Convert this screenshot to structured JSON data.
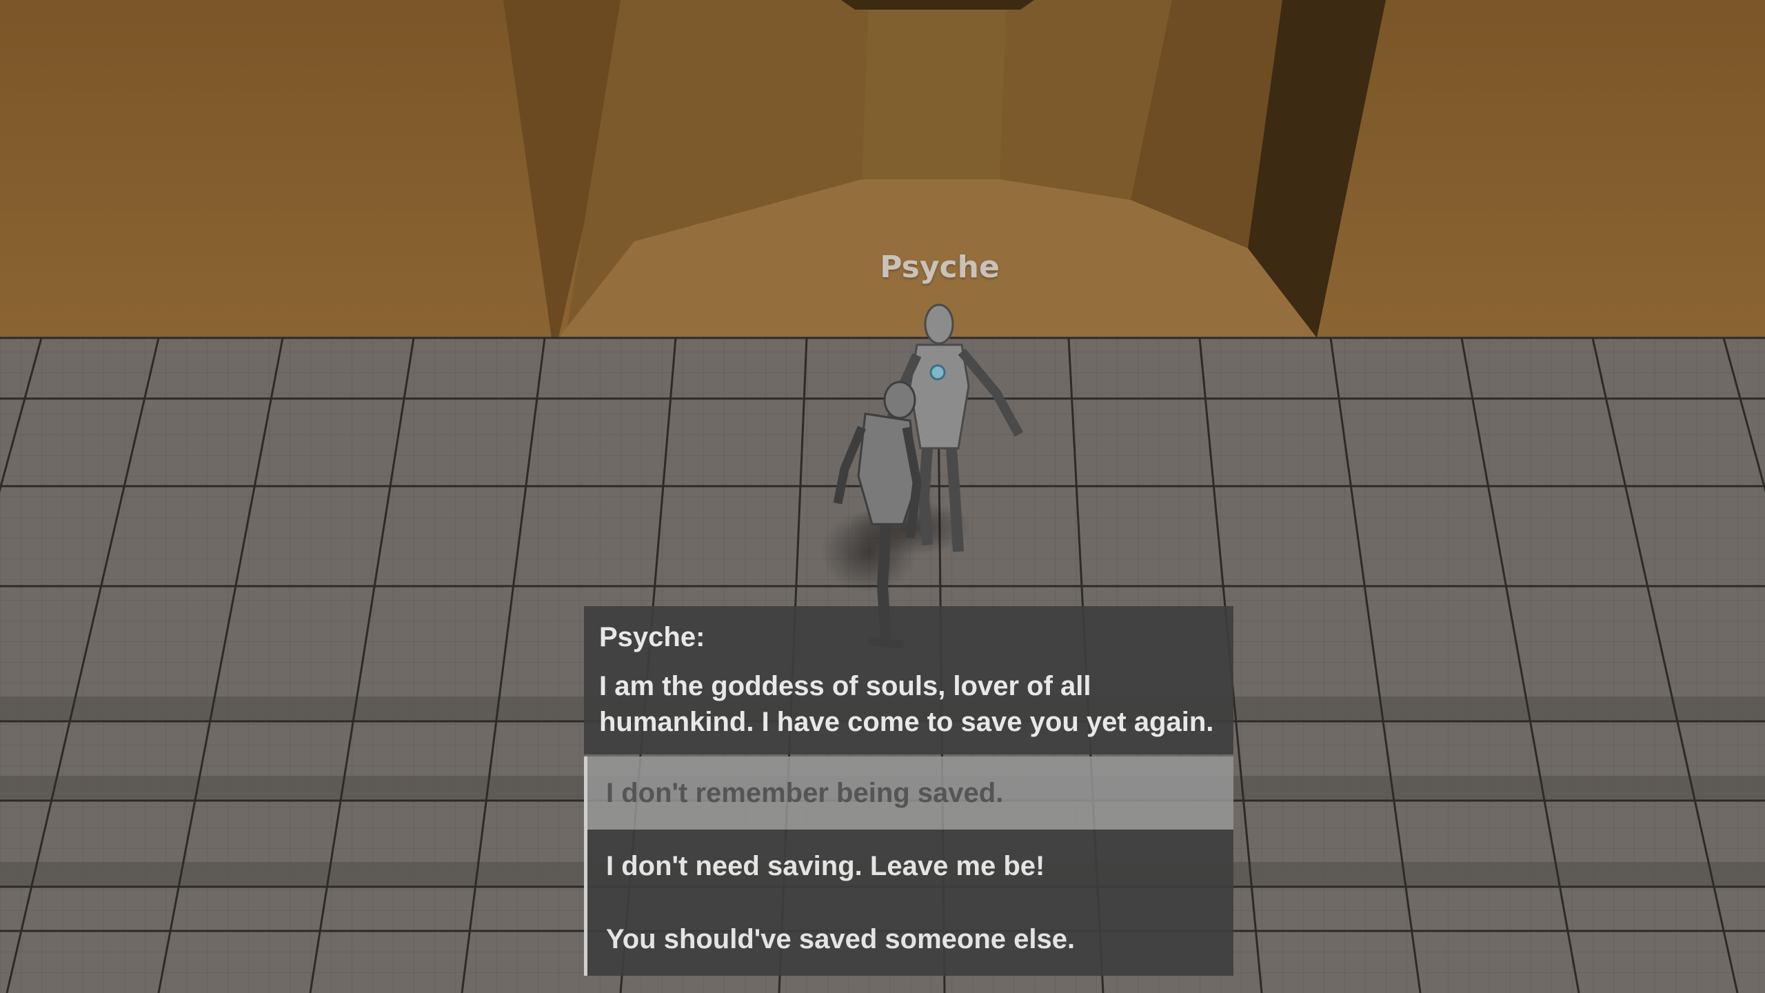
{
  "world": {
    "npc_nameplate": "Psyche"
  },
  "dialog": {
    "speaker": "Psyche:",
    "line": "I am the goddess of souls, lover of all humankind. I have come to save you yet again."
  },
  "choices": [
    {
      "label": "I don't remember being saved.",
      "state": "hovered"
    },
    {
      "label": "I don't need saving. Leave me be!",
      "state": "normal"
    },
    {
      "label": "You should've saved someone else.",
      "state": "normal"
    }
  ],
  "colors": {
    "sky_wall": "#8b6432",
    "floor": "#6f6a66",
    "dialog_bg": "#3e3e3e",
    "choice_hover_bg": "#969696"
  }
}
